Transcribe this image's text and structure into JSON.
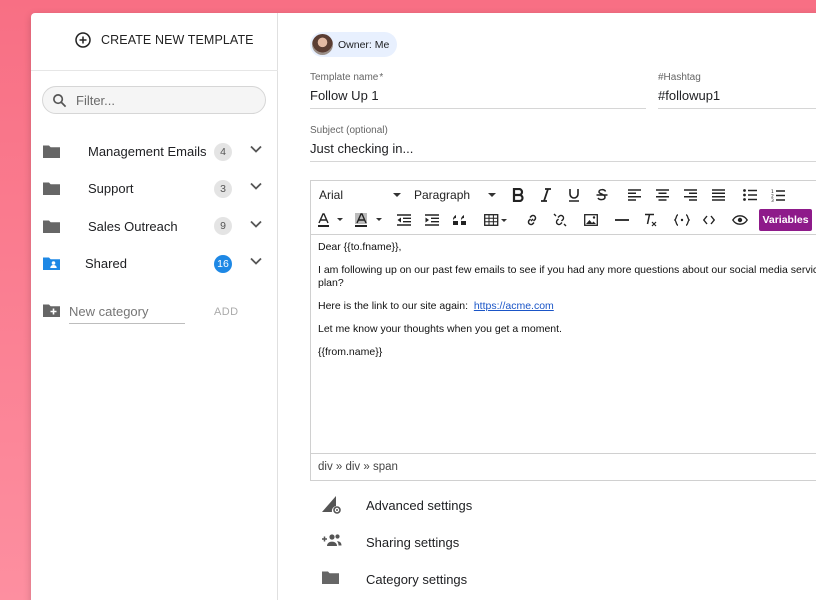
{
  "sidebar": {
    "create_label": "CREATE NEW TEMPLATE",
    "filter_placeholder": "Filter...",
    "categories": [
      {
        "name": "Management Emails",
        "count": "4"
      },
      {
        "name": "Support",
        "count": "3"
      },
      {
        "name": "Sales Outreach",
        "count": "9"
      },
      {
        "name": "Shared",
        "count": "16"
      }
    ],
    "new_category_placeholder": "New category",
    "add_label": "ADD"
  },
  "main": {
    "owner_label": "Owner: Me",
    "template_name_label": "Template name",
    "template_name_required": "*",
    "template_name_value": "Follow Up 1",
    "hashtag_label": "#Hashtag",
    "hashtag_value": "#followup1",
    "subject_label": "Subject (optional)",
    "subject_value": "Just checking in...",
    "toolbar": {
      "font_family": "Arial",
      "block_format": "Paragraph",
      "variables_label": "Variables"
    },
    "body": {
      "greeting": "Dear {{to.fname}},",
      "para1": "I am following up on our past few emails to see if you had any more questions about our social media service or plan?",
      "link_prefix": "Here is the link to our site again:",
      "link_text": "https://acme.com",
      "para3": "Let me know your thoughts when you get a moment.",
      "signature": "{{from.name}}"
    },
    "status_path": "div » div » span",
    "settings": [
      {
        "label": "Advanced settings",
        "icon": "advanced-settings-icon"
      },
      {
        "label": "Sharing settings",
        "icon": "group-add-icon"
      },
      {
        "label": "Category settings",
        "icon": "folder-icon"
      }
    ]
  },
  "colors": {
    "background": "#f86f84",
    "accent_blue": "#1e88e5",
    "variables_purple": "#8e1a8a",
    "link": "#1a55c7"
  }
}
